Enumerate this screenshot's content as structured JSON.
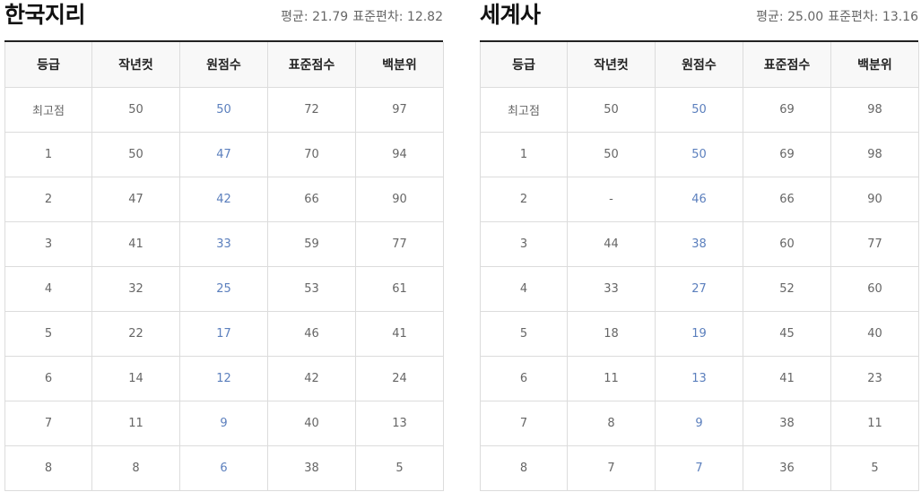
{
  "columns": [
    "등급",
    "작년컷",
    "원점수",
    "표준점수",
    "백분위"
  ],
  "subjects": [
    {
      "title": "한국지리",
      "mean_label": "평균:",
      "mean_value": "21.79",
      "sd_label": "표준편차:",
      "sd_value": "12.82",
      "rows": [
        {
          "grade": "최고점",
          "last_year": "50",
          "raw": "50",
          "standard": "72",
          "percentile": "97"
        },
        {
          "grade": "1",
          "last_year": "50",
          "raw": "47",
          "standard": "70",
          "percentile": "94"
        },
        {
          "grade": "2",
          "last_year": "47",
          "raw": "42",
          "standard": "66",
          "percentile": "90"
        },
        {
          "grade": "3",
          "last_year": "41",
          "raw": "33",
          "standard": "59",
          "percentile": "77"
        },
        {
          "grade": "4",
          "last_year": "32",
          "raw": "25",
          "standard": "53",
          "percentile": "61"
        },
        {
          "grade": "5",
          "last_year": "22",
          "raw": "17",
          "standard": "46",
          "percentile": "41"
        },
        {
          "grade": "6",
          "last_year": "14",
          "raw": "12",
          "standard": "42",
          "percentile": "24"
        },
        {
          "grade": "7",
          "last_year": "11",
          "raw": "9",
          "standard": "40",
          "percentile": "13"
        },
        {
          "grade": "8",
          "last_year": "8",
          "raw": "6",
          "standard": "38",
          "percentile": "5"
        }
      ]
    },
    {
      "title": "세계사",
      "mean_label": "평균:",
      "mean_value": "25.00",
      "sd_label": "표준편차:",
      "sd_value": "13.16",
      "rows": [
        {
          "grade": "최고점",
          "last_year": "50",
          "raw": "50",
          "standard": "69",
          "percentile": "98"
        },
        {
          "grade": "1",
          "last_year": "50",
          "raw": "50",
          "standard": "69",
          "percentile": "98"
        },
        {
          "grade": "2",
          "last_year": "-",
          "raw": "46",
          "standard": "66",
          "percentile": "90"
        },
        {
          "grade": "3",
          "last_year": "44",
          "raw": "38",
          "standard": "60",
          "percentile": "77"
        },
        {
          "grade": "4",
          "last_year": "33",
          "raw": "27",
          "standard": "52",
          "percentile": "60"
        },
        {
          "grade": "5",
          "last_year": "18",
          "raw": "19",
          "standard": "45",
          "percentile": "40"
        },
        {
          "grade": "6",
          "last_year": "11",
          "raw": "13",
          "standard": "41",
          "percentile": "23"
        },
        {
          "grade": "7",
          "last_year": "8",
          "raw": "9",
          "standard": "38",
          "percentile": "11"
        },
        {
          "grade": "8",
          "last_year": "7",
          "raw": "7",
          "standard": "36",
          "percentile": "5"
        }
      ]
    }
  ],
  "colors": {
    "raw_score_text": "#5b7fbd",
    "header_background": "#f8f8f8",
    "title_rule": "#222222",
    "cell_border": "#dcdcdc"
  }
}
